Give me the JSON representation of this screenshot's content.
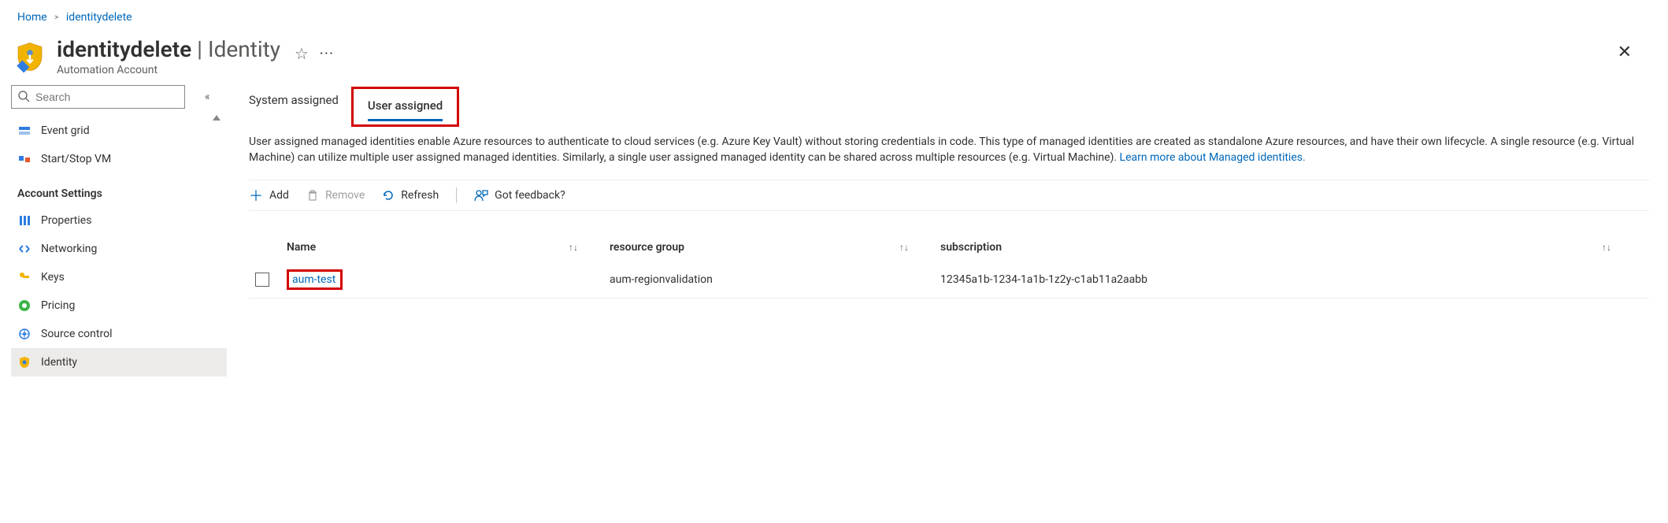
{
  "breadcrumb": {
    "home": "Home",
    "current": "identitydelete"
  },
  "header": {
    "title": "identitydelete",
    "section": "Identity",
    "subtitle": "Automation Account"
  },
  "sidebar": {
    "search_placeholder": "Search",
    "items_top": {
      "event_grid": "Event grid",
      "start_stop_vm": "Start/Stop VM"
    },
    "section_label": "Account Settings",
    "items": {
      "properties": "Properties",
      "networking": "Networking",
      "keys": "Keys",
      "pricing": "Pricing",
      "source_control": "Source control",
      "identity": "Identity"
    }
  },
  "tabs": {
    "system": "System assigned",
    "user": "User assigned"
  },
  "description": {
    "text": "User assigned managed identities enable Azure resources to authenticate to cloud services (e.g. Azure Key Vault) without storing credentials in code. This type of managed identities are created as standalone Azure resources, and have their own lifecycle. A single resource (e.g. Virtual Machine) can utilize multiple user assigned managed identities. Similarly, a single user assigned managed identity can be shared across multiple resources (e.g. Virtual Machine). ",
    "link": "Learn more about Managed identities."
  },
  "toolbar": {
    "add": "Add",
    "remove": "Remove",
    "refresh": "Refresh",
    "feedback": "Got feedback?"
  },
  "table": {
    "headers": {
      "name": "Name",
      "rg": "resource group",
      "sub": "subscription"
    },
    "rows": [
      {
        "name": "aum-test",
        "rg": "aum-regionvalidation",
        "sub": "12345a1b-1234-1a1b-1z2y-c1ab11a2aabb"
      }
    ]
  }
}
